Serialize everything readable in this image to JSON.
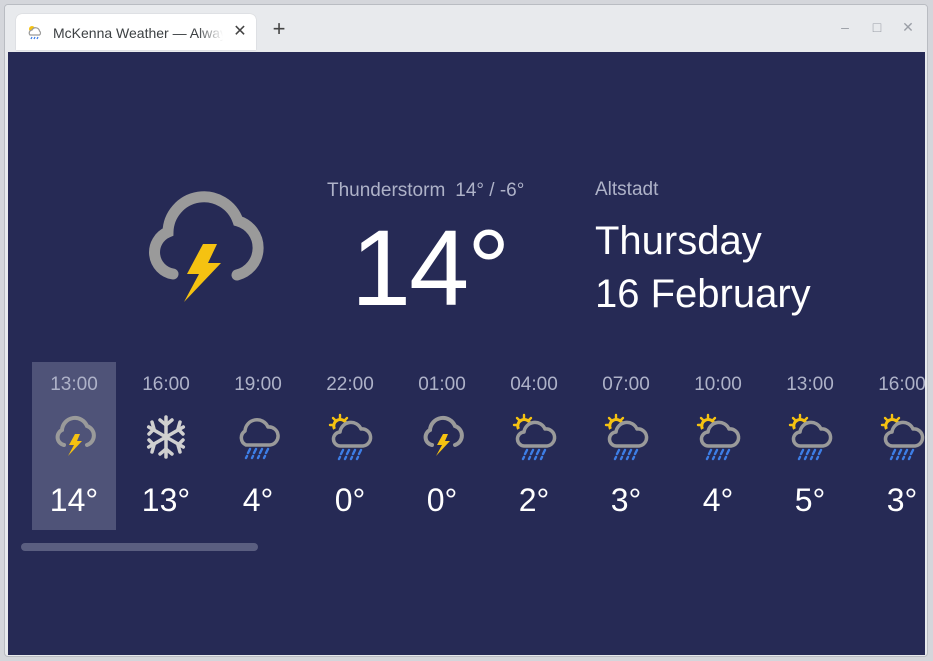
{
  "browser": {
    "tab_title": "McKenna Weather — Always ready for the weather",
    "close_glyph": "✕",
    "new_tab_glyph": "+",
    "controls": {
      "minimize": "–",
      "maximize": "□",
      "close": "✕"
    }
  },
  "current": {
    "condition": "Thunderstorm",
    "high_low": "14° / -6°",
    "temperature": "14°",
    "icon": "thunderstorm-icon"
  },
  "location": {
    "name": "Altstadt",
    "day": "Thursday",
    "date": "16 February"
  },
  "hourly": [
    {
      "time": "13:00",
      "temp": "14°",
      "icon": "thunderstorm-icon",
      "selected": true
    },
    {
      "time": "16:00",
      "temp": "13°",
      "icon": "snowflake-icon"
    },
    {
      "time": "19:00",
      "temp": "4°",
      "icon": "rain-icon"
    },
    {
      "time": "22:00",
      "temp": "0°",
      "icon": "sun-rain-icon"
    },
    {
      "time": "01:00",
      "temp": "0°",
      "icon": "thunderstorm-icon"
    },
    {
      "time": "04:00",
      "temp": "2°",
      "icon": "sun-rain-icon"
    },
    {
      "time": "07:00",
      "temp": "3°",
      "icon": "sun-rain-icon"
    },
    {
      "time": "10:00",
      "temp": "4°",
      "icon": "sun-rain-icon"
    },
    {
      "time": "13:00",
      "temp": "5°",
      "icon": "sun-rain-icon"
    },
    {
      "time": "16:00",
      "temp": "3°",
      "icon": "sun-rain-icon"
    }
  ],
  "colors": {
    "background": "#262a55",
    "selected": "#4f5378",
    "cloud": "#9a9a9a",
    "bolt": "#f5c211",
    "sun": "#f5c211",
    "rain": "#3d7ee6"
  }
}
